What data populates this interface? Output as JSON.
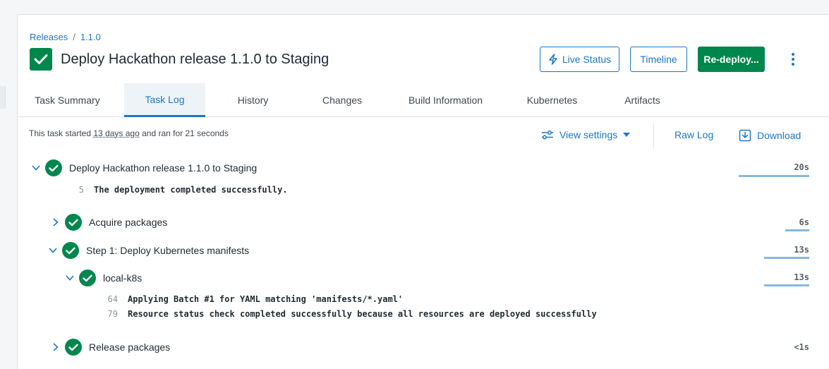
{
  "breadcrumb": {
    "parent": "Releases",
    "separator": "/",
    "current": "1.1.0"
  },
  "page": {
    "title": "Deploy Hackathon release 1.1.0 to Staging",
    "status_color": "#00874d"
  },
  "header_actions": {
    "live_status": "Live Status",
    "timeline": "Timeline",
    "redeploy": "Re-deploy..."
  },
  "tabs": [
    {
      "label": "Task Summary",
      "active": false
    },
    {
      "label": "Task Log",
      "active": true
    },
    {
      "label": "History",
      "active": false
    },
    {
      "label": "Changes",
      "active": false
    },
    {
      "label": "Build Information",
      "active": false
    },
    {
      "label": "Kubernetes",
      "active": false
    },
    {
      "label": "Artifacts",
      "active": false
    }
  ],
  "task_info": {
    "prefix": "This task started",
    "ago": "13 days ago",
    "suffix": "and ran for 21 seconds"
  },
  "toolbar": {
    "view_settings": "View settings",
    "raw_log": "Raw Log",
    "download": "Download"
  },
  "log_tree": {
    "root": {
      "label": "Deploy Hackathon release 1.1.0 to Staging",
      "duration": "20s",
      "lines": [
        {
          "number": "5",
          "text": "The deployment completed successfully."
        }
      ]
    },
    "acquire": {
      "label": "Acquire packages",
      "duration": "6s"
    },
    "step1": {
      "label": "Step 1: Deploy Kubernetes manifests",
      "duration": "13s"
    },
    "local": {
      "label": "local-k8s",
      "duration": "13s",
      "lines": [
        {
          "number": "64",
          "text": "Applying Batch #1 for YAML matching 'manifests/*.yaml'"
        },
        {
          "number": "79",
          "text": "Resource status check completed successfully because all resources are deployed successfully"
        }
      ]
    },
    "release": {
      "label": "Release packages",
      "duration": "<1s"
    }
  },
  "colors": {
    "accent": "#1a77ca",
    "success": "#00874d",
    "bar": "#87b8df"
  }
}
